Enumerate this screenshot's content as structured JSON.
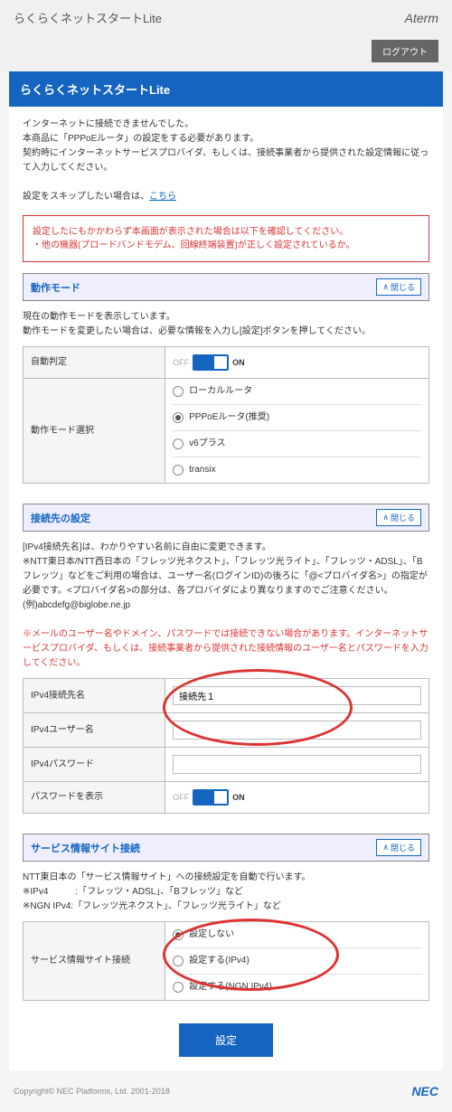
{
  "header": {
    "title": "らくらくネットスタートLite",
    "brand": "Aterm",
    "logout": "ログアウト"
  },
  "titleBar": "らくらくネットスタートLite",
  "intro": {
    "l1": "インターネットに接続できませんでした。",
    "l2": "本商品に「PPPoEルータ」の設定をする必要があります。",
    "l3": "契約時にインターネットサービスプロバイダ、もしくは、接続事業者から提供された設定情報に従って入力してください。",
    "skipPrefix": "設定をスキップしたい場合は、",
    "skipLink": "こちら"
  },
  "warning": {
    "l1": "設定したにもかかわらず本画面が表示された場合は以下を確認してください。",
    "l2": "・他の機器(ブロードバンドモデム、回線終端装置)が正しく設定されているか。"
  },
  "mode": {
    "heading": "動作モード",
    "close": "閉じる",
    "desc1": "現在の動作モードを表示しています。",
    "desc2": "動作モードを変更したい場合は、必要な情報を入力し[設定]ボタンを押してください。",
    "autoLabel": "自動判定",
    "off": "OFF",
    "on": "ON",
    "selectLabel": "動作モード選択",
    "opt1": "ローカルルータ",
    "opt2": "PPPoEルータ(推奨)",
    "opt3": "v6プラス",
    "opt4": "transix"
  },
  "conn": {
    "heading": "接続先の設定",
    "close": "閉じる",
    "d1": "[IPv4接続先名]は、わかりやすい名前に自由に変更できます。",
    "d2": "※NTT東日本/NTT西日本の「フレッツ光ネクスト」、「フレッツ光ライト」、「フレッツ・ADSL」、「Bフレッツ」などをご利用の場合は、ユーザー名(ログインID)の後ろに「@<プロバイダ名>」の指定が必要です。<プロバイダ名>の部分は、各プロバイダにより異なりますのでご注意ください。",
    "d3": "(例)abcdefg@biglobe.ne.jp",
    "warn": "※メールのユーザー名やドメイン、パスワードでは接続できない場合があります。インターネットサービスプロバイダ、もしくは、接続事業者から提供された接続情報のユーザー名とパスワードを入力してください。",
    "f1": "IPv4接続先名",
    "f1v": "接続先１",
    "f2": "IPv4ユーザー名",
    "f3": "IPv4パスワード",
    "f4": "パスワードを表示",
    "off": "OFF",
    "on": "ON"
  },
  "svc": {
    "heading": "サービス情報サイト接続",
    "close": "閉じる",
    "d1": "NTT東日本の「サービス情報サイト」への接続設定を自動で行います。",
    "d2": "※IPv4　　　:「フレッツ・ADSL」、「Bフレッツ」など",
    "d3": "※NGN IPv4:「フレッツ光ネクスト」、「フレッツ光ライト」など",
    "label": "サービス情報サイト接続",
    "o1": "設定しない",
    "o2": "設定する(IPv4)",
    "o3": "設定する(NGN IPv4)"
  },
  "submit": "設定",
  "footer": {
    "copy": "Copyright© NEC Platforms, Ltd. 2001-2018",
    "brand": "NEC"
  }
}
